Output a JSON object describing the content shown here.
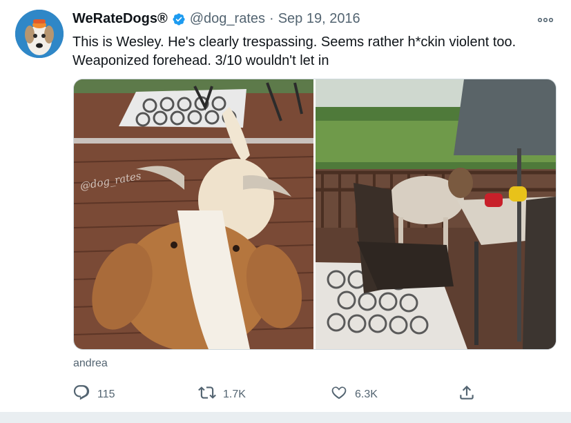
{
  "account": {
    "display_name": "WeRateDogs",
    "registered_mark": "®",
    "handle": "@dog_rates",
    "separator": "·",
    "date": "Sep 19, 2016"
  },
  "tweet": {
    "line1": "This is Wesley. He's clearly trespassing. Seems rather h*ckin violent too.",
    "line2": "Weaponized forehead. 3/10 wouldn't let in"
  },
  "media": {
    "watermark": "@dog_rates"
  },
  "caption": "andrea",
  "actions": {
    "reply_count": "115",
    "retweet_count": "1.7K",
    "like_count": "6.3K"
  },
  "colors": {
    "accent": "#1d9bf0",
    "muted": "#536471",
    "text": "#0f1419"
  },
  "icons": {
    "verified": "verified-badge-icon",
    "more": "more-icon",
    "reply": "reply-icon",
    "retweet": "retweet-icon",
    "like": "heart-icon",
    "share": "share-icon"
  }
}
